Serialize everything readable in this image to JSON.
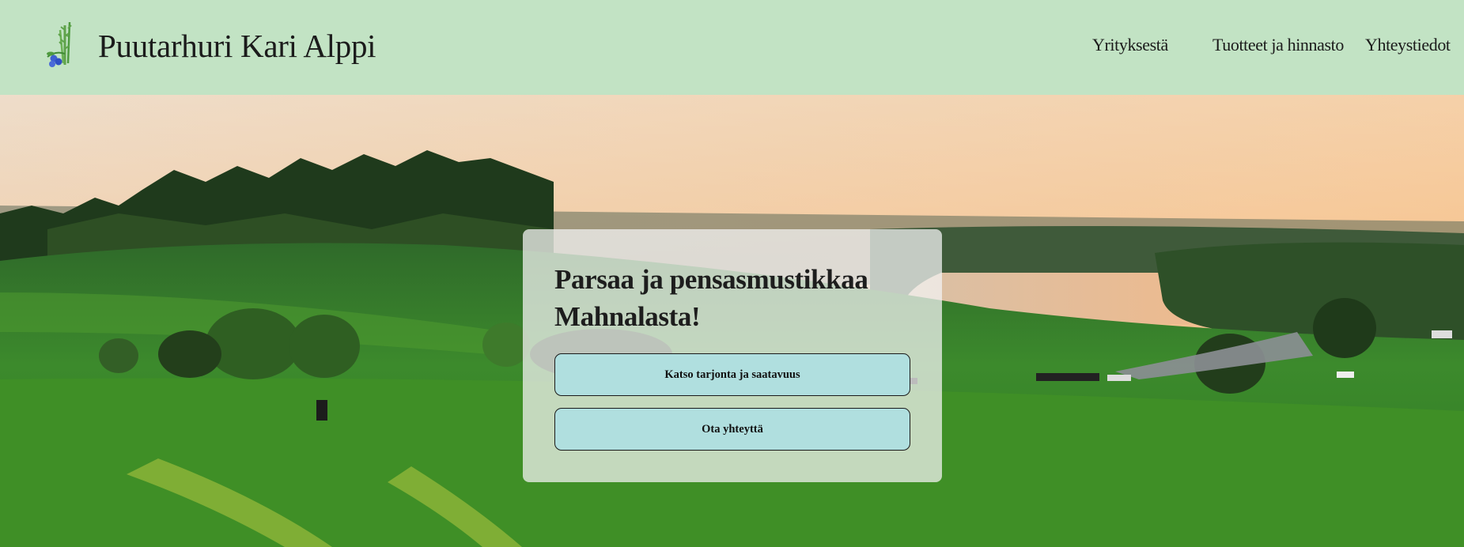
{
  "header": {
    "title": "Puutarhuri Kari Alppi",
    "logo_icon": "asparagus-blueberry-logo-icon",
    "nav": [
      {
        "label": "Yrityksestä"
      },
      {
        "label": "Tuotteet ja hinnasto"
      },
      {
        "label": "Yhteystiedot"
      }
    ]
  },
  "hero": {
    "image": "sunset-countryside-lake-landscape",
    "card": {
      "title": "Parsaa ja pensasmustikkaa Mahnalasta!",
      "primary_button": "Katso tarjonta ja saatavuus",
      "secondary_button": "Ota yhteyttä"
    }
  },
  "colors": {
    "header_bg": "#c2e3c4",
    "button_bg": "#b0dfdf",
    "text": "#1b1b1b"
  }
}
